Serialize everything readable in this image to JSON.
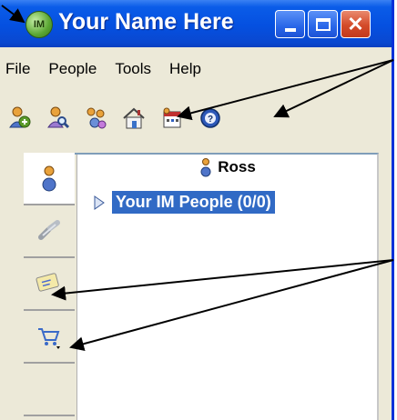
{
  "window": {
    "title": "Your Name Here",
    "logo_text": "IM",
    "buttons": {
      "minimize": "_",
      "maximize": "□",
      "close": "✕"
    }
  },
  "menu": {
    "items": [
      "File",
      "People",
      "Tools",
      "Help"
    ]
  },
  "toolbar": {
    "icons": [
      "add-person-icon",
      "find-person-icon",
      "people-icon",
      "home-icon",
      "calendar-icon",
      "help-icon"
    ]
  },
  "sidebar": {
    "tabs": [
      "people-icon",
      "link-icon",
      "card-dropdown-icon",
      "cart-dropdown-icon"
    ]
  },
  "list": {
    "header": "Ross",
    "group": {
      "label": "Your IM People (0/0)"
    }
  },
  "colors": {
    "titlebar": "#0550e0",
    "selection": "#316ac5",
    "close": "#d44b2a"
  }
}
